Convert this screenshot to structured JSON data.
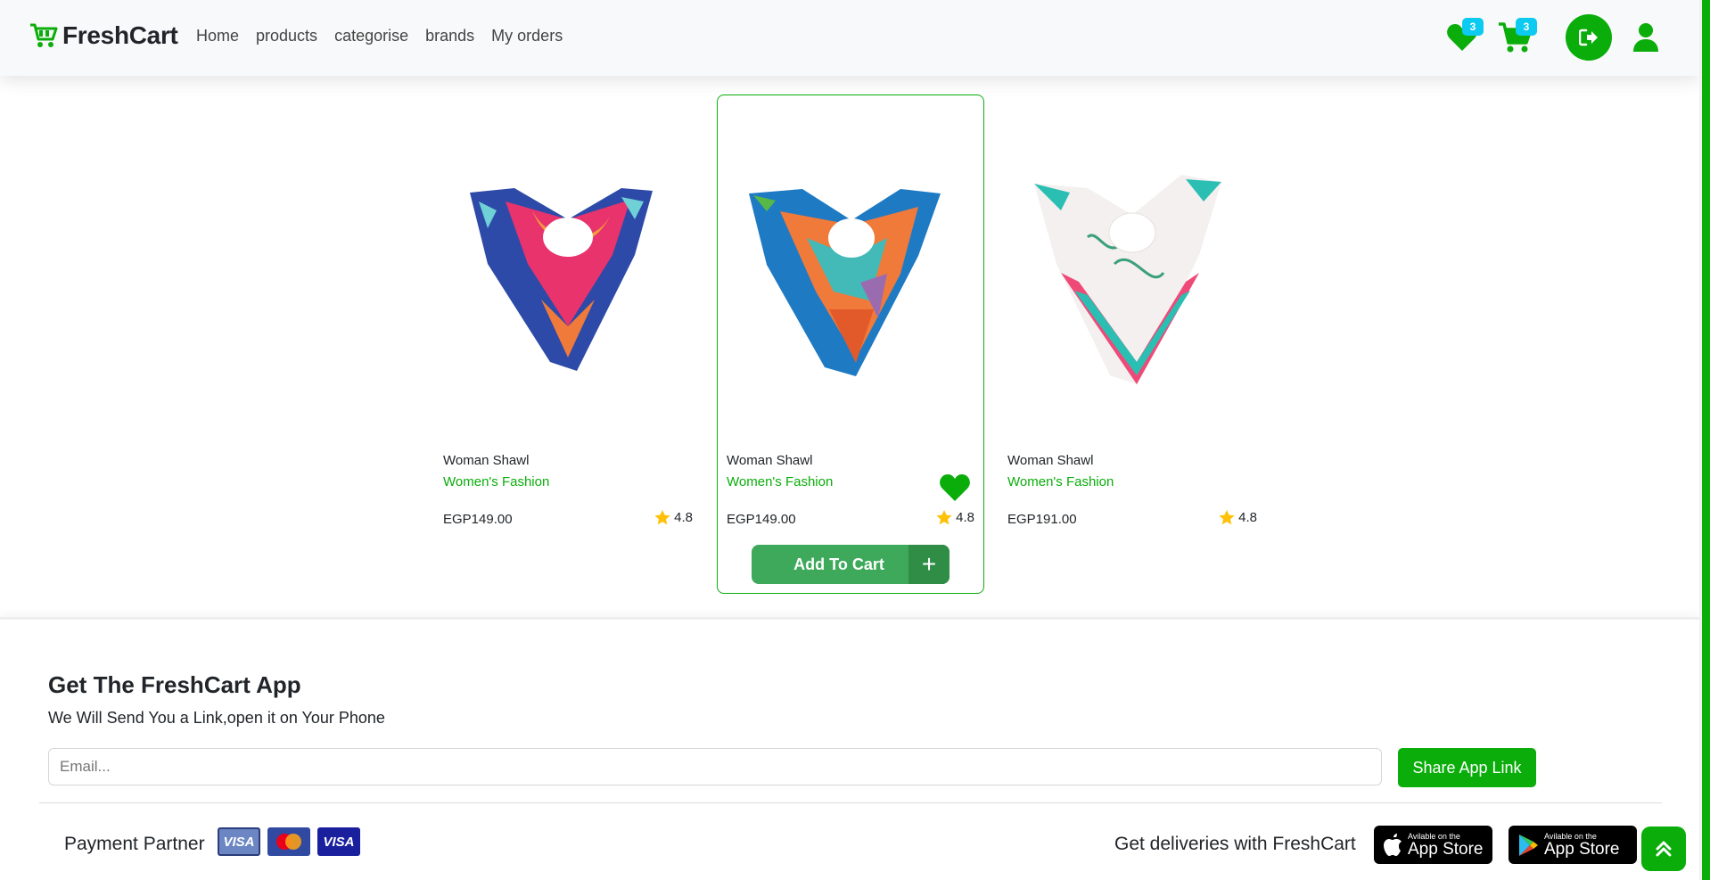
{
  "navbar": {
    "brand": "FreshCart",
    "links": [
      "Home",
      "products",
      "categorise",
      "brands",
      "My orders"
    ],
    "wishlist_count": "3",
    "cart_count": "3"
  },
  "products": [
    {
      "title": "Woman Shawl",
      "category": "Women's Fashion",
      "price": "EGP149.00",
      "rating": "4.8"
    },
    {
      "title": "Woman Shawl",
      "category": "Women's Fashion",
      "price": "EGP149.00",
      "rating": "4.8",
      "button": "Add To Cart"
    },
    {
      "title": "Woman Shawl",
      "category": "Women's Fashion",
      "price": "EGP191.00",
      "rating": "4.8"
    }
  ],
  "footer": {
    "app_title": "Get The FreshCart App",
    "app_subtitle": "We Will Send You a Link,open it on Your Phone",
    "email_placeholder": "Email...",
    "share_button": "Share App Link",
    "payment_label": "Payment Partner",
    "delivery_label": "Get deliveries with FreshCart",
    "store_badges": [
      {
        "small": "Avilable on the",
        "big": "App Store"
      },
      {
        "small": "Avilable on the",
        "big": "App Store"
      }
    ]
  },
  "colors": {
    "accent": "#0aad0a",
    "badge": "#0dcaf0",
    "star": "#ffc107"
  }
}
